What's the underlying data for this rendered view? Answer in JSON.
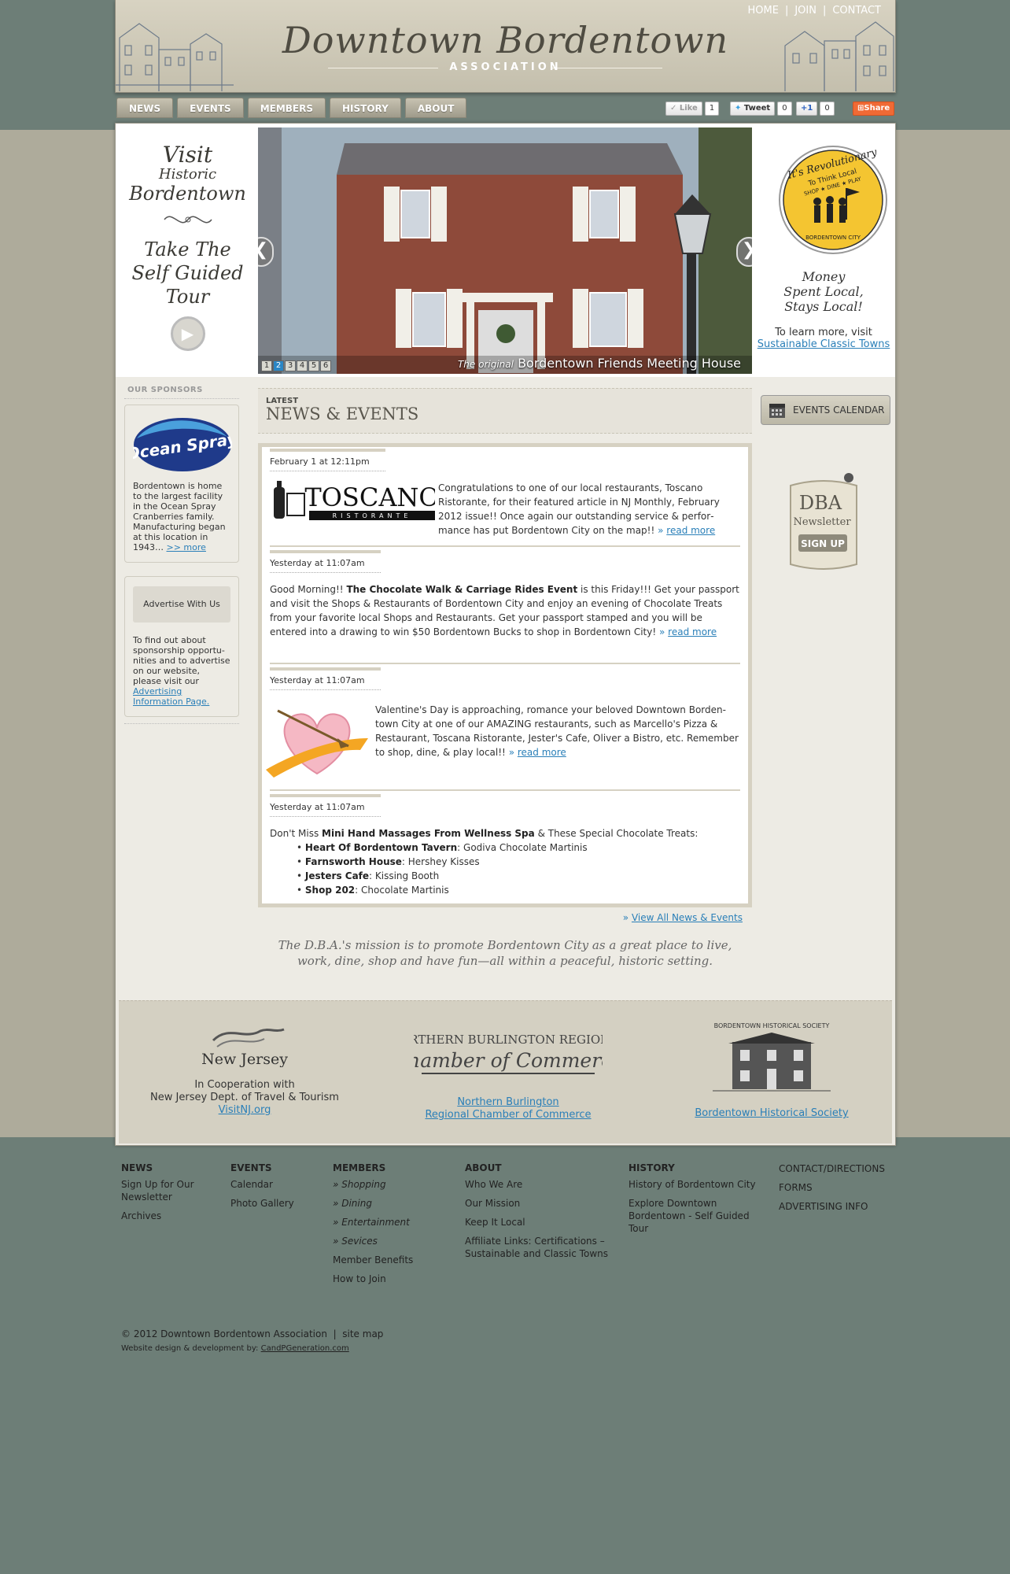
{
  "header": {
    "title": "Downtown Bordentown",
    "subtitle": "ASSOCIATION",
    "toplinks": [
      "HOME",
      "JOIN",
      "CONTACT"
    ],
    "separator": "|"
  },
  "nav": {
    "tabs": [
      "NEWS",
      "EVENTS",
      "MEMBERS",
      "HISTORY",
      "ABOUT"
    ]
  },
  "social": {
    "like": "Like",
    "like_count": "1",
    "tweet": "Tweet",
    "tweet_count": "0",
    "plus": "+1",
    "plus_count": "0",
    "share": "Share"
  },
  "visit": {
    "l1": "Visit",
    "l2": "Historic",
    "l3": "Bordentown",
    "t1": "Take The",
    "t2": "Self Guided",
    "t3": "Tour"
  },
  "slideshow": {
    "prev": "❮",
    "next": "❯",
    "dots": [
      "1",
      "2",
      "3",
      "4",
      "5",
      "6"
    ],
    "active_dot": 2,
    "caption_small": "The original",
    "caption": "Bordentown Friends Meeting House"
  },
  "revolution": {
    "badge_top": "It's Revolutionary",
    "badge_mid": "To Think Local",
    "badge_sub": "SHOP ★ DINE ★ PLAY",
    "badge_bottom": "BORDENTOWN CITY",
    "tag1": "Money",
    "tag2": "Spent Local,",
    "tag3": "Stays Local!",
    "learn": "To learn more, visit",
    "link": "Sustainable Classic Towns"
  },
  "sidebar": {
    "heading": "OUR SPONSORS",
    "ocean_logo": "Ocean Spray",
    "ocean_text": "Bordentown is home to the largest facility in the Ocean Spray Cranberries family. Manufacturing began at this location in 1943…",
    "ocean_more": ">> more",
    "advertise_title": "Advertise With Us",
    "advertise_text": "To find out about sponsorship opportu­nities and to advertise on our website, please visit our",
    "advertise_link": "Advertising Information Page."
  },
  "news": {
    "latest": "LATEST",
    "title": "NEWS & EVENTS",
    "read_more": "read more",
    "read_prefix": "»",
    "view_all": "View All News & Events",
    "entries": [
      {
        "date": "February 1 at 12:11pm",
        "logo": "TOSCANO",
        "logo_sub": "RISTORANTE",
        "text": "Congratulations to one of our local restaurants, Toscano Ristorante, for their featured article in NJ Monthly, February 2012 issue!! Once again our outstanding service & perfor­mance has put Bordentown City on the map!!"
      },
      {
        "date": "Yesterday at 11:07am",
        "pre": "Good Morning!! ",
        "bold": "The Chocolate Walk & Carriage Rides Event",
        "text": " is this Friday!!! Get your passport and visit the Shops & Restaurants of Bordentown City and enjoy an evening of Chocolate Treats from your favorite local Shops and Restaurants. Get your passport stamped and you will be entered into a drawing to win $50 Bordentown Bucks to shop in Bordentown City!"
      },
      {
        "date": "Yesterday at 11:07am",
        "text": "Valentine's Day is approaching, romance your beloved Downtown Borden­town City at one of our AMAZING restaurants, such as Marcello's Pizza & Restaurant, Toscana Ristorante, Jester's Cafe, Oliver a Bistro, etc. Remem­ber to shop, dine, & play local!!"
      },
      {
        "date": "Yesterday at 11:07am",
        "pre": "Don't Miss ",
        "bold": "Mini Hand Massages From Wellness Spa",
        "text": " & These Special Chocolate Treats:",
        "items": [
          {
            "b": "Heart Of Bordentown Tavern",
            "t": ": Godiva Chocolate Martinis"
          },
          {
            "b": "Farnsworth House",
            "t": ": Hershey Kisses"
          },
          {
            "b": "Jesters Cafe",
            "t": ": Kissing Booth"
          },
          {
            "b": "Shop 202",
            "t": ": Chocolate Martinis"
          }
        ]
      }
    ]
  },
  "mission": {
    "l1": "The D.B.A.'s mission is to promote Bordentown City as a great place to live,",
    "l2": "work, dine, shop and have fun—all within a peaceful, historic setting."
  },
  "rightcol": {
    "calendar": "EVENTS CALENDAR",
    "dba1": "DBA",
    "dba2": "Newsletter",
    "dba3": "SIGN UP"
  },
  "partners": [
    {
      "logo": "New Jersey",
      "l1": "In Cooperation with",
      "l2": "New Jersey Dept. of Travel & Tourism",
      "link": "VisitNJ.org"
    },
    {
      "logo1": "NORTHERN BURLINGTON REGIONAL",
      "logo2": "Chamber of Commerce",
      "link1": "Northern Burlington",
      "link2": "Regional Chamber of Commerce"
    },
    {
      "logo": "BORDENTOWN HISTORICAL SOCIETY",
      "link": "Bordentown Historical Society"
    }
  ],
  "footer": {
    "news": {
      "h": "NEWS",
      "items": [
        "Sign Up for Our Newsletter",
        "Archives"
      ]
    },
    "events": {
      "h": "EVENTS",
      "items": [
        "Calendar",
        "Photo Gallery"
      ]
    },
    "members": {
      "h": "MEMBERS",
      "items": [
        "Shopping",
        "Dining",
        "Entertainment",
        "Sevices",
        "Member Benefits",
        "How to Join"
      ]
    },
    "about": {
      "h": "ABOUT",
      "items": [
        "Who We Are",
        "Our Mission",
        "Keep It Local",
        "Affiliate Links: Certifications – Sustainable and Classic Towns"
      ]
    },
    "history": {
      "h": "HISTORY",
      "items": [
        "History of Bordentown City",
        "Explore Downtown Bordentown - Self Guided Tour"
      ]
    },
    "contact": {
      "items": [
        "CONTACT/DIRECTIONS",
        "FORMS",
        "ADVERTISING INFO"
      ]
    },
    "copyright": "© 2012 Downtown Bordentown Association  |  site map",
    "credit": "Website design & development by:",
    "credit_link": "CandPGeneration.com"
  }
}
